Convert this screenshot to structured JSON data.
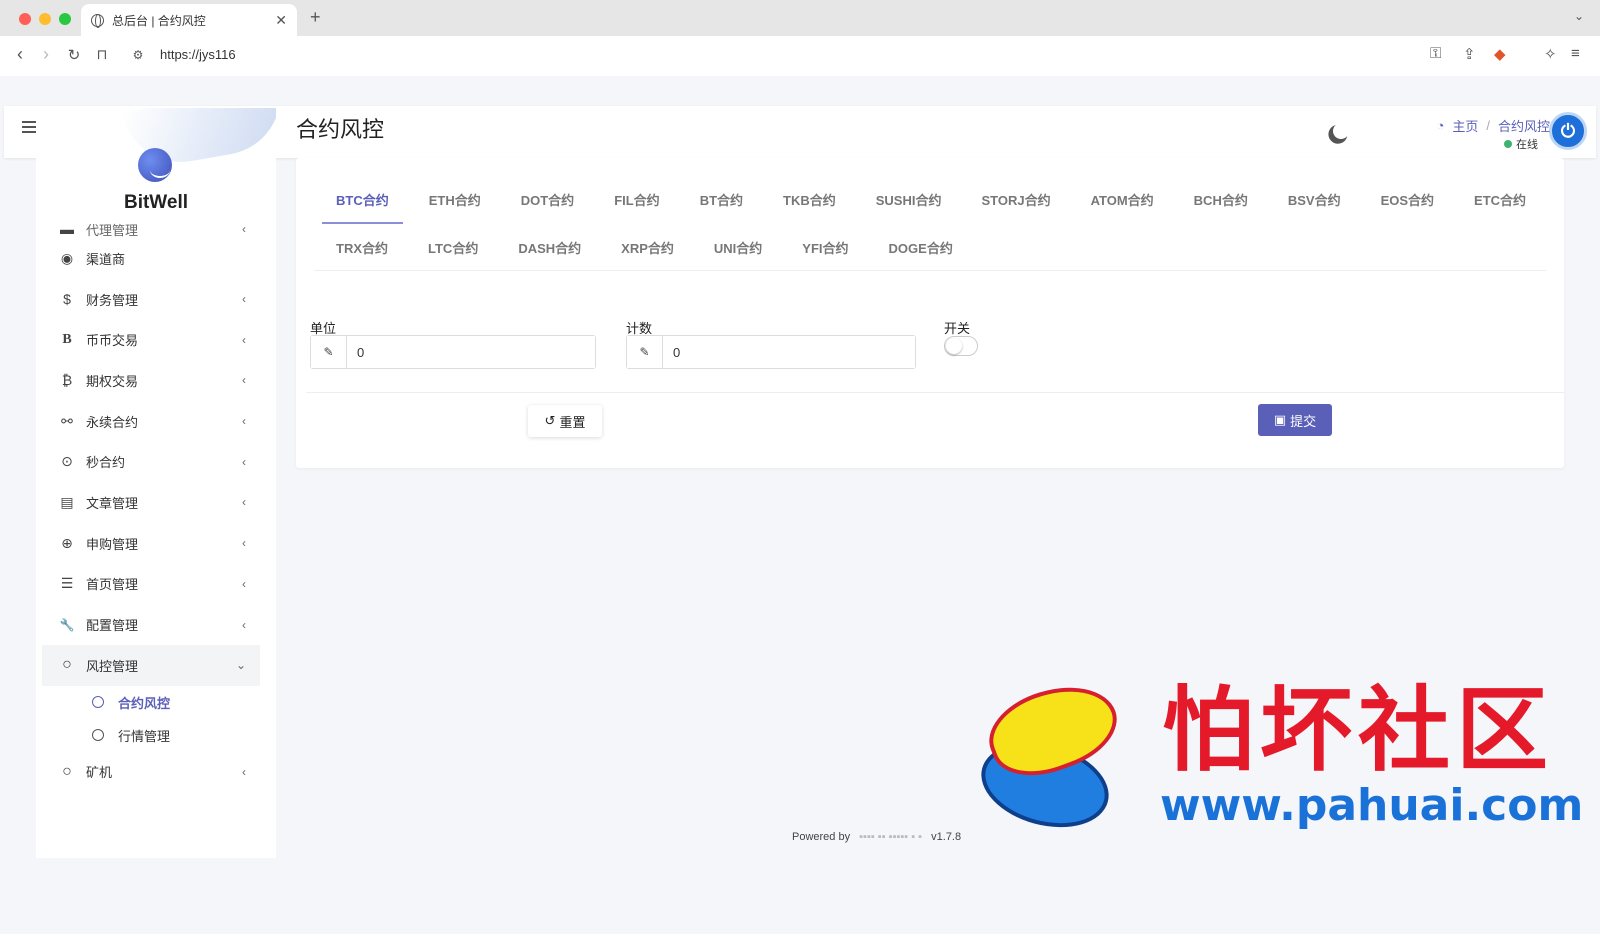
{
  "browser": {
    "tab_title": "总后台 | 合约风控",
    "url": "https://jys116",
    "new_tab": "+",
    "tab_close": "✕",
    "tab_menu": "⌄"
  },
  "topnav": {
    "status": "在线",
    "status_color": "#3cb371"
  },
  "sidebar": {
    "brand": "BitWell",
    "items": [
      {
        "label": "代理管理",
        "icon": "agent-icon",
        "glyph": "▬",
        "chevron": "‹"
      },
      {
        "label": "渠道商",
        "icon": "user-circle-icon",
        "glyph": "◉",
        "chevron": ""
      },
      {
        "label": "财务管理",
        "icon": "dollar-icon",
        "glyph": "$",
        "chevron": "‹"
      },
      {
        "label": "币币交易",
        "icon": "bold-b-icon",
        "glyph": "B",
        "chevron": "‹"
      },
      {
        "label": "期权交易",
        "icon": "bitcoin-icon",
        "glyph": "₿",
        "chevron": "‹"
      },
      {
        "label": "永续合约",
        "icon": "link-icon",
        "glyph": "⚯",
        "chevron": "‹"
      },
      {
        "label": "秒合约",
        "icon": "dot-circle-icon",
        "glyph": "⊙",
        "chevron": "‹"
      },
      {
        "label": "文章管理",
        "icon": "newspaper-icon",
        "glyph": "▤",
        "chevron": "‹"
      },
      {
        "label": "申购管理",
        "icon": "life-ring-icon",
        "glyph": "⊕",
        "chevron": "‹"
      },
      {
        "label": "首页管理",
        "icon": "list-icon",
        "glyph": "☰",
        "chevron": "‹"
      },
      {
        "label": "配置管理",
        "icon": "wrench-icon",
        "glyph": "🔧",
        "chevron": "‹"
      },
      {
        "label": "风控管理",
        "icon": "circle-icon",
        "glyph": "○",
        "chevron": "⌄"
      }
    ],
    "subitems": [
      {
        "label": "合约风控"
      },
      {
        "label": "行情管理"
      }
    ],
    "last_item": {
      "label": "矿机",
      "icon": "circle-icon",
      "glyph": "○",
      "chevron": "‹"
    }
  },
  "content": {
    "page_title": "合约风控",
    "breadcrumb": {
      "home": "主页",
      "separator": "/",
      "current": "合约风控"
    },
    "tabs_row1": [
      "BTC合约",
      "ETH合约",
      "DOT合约",
      "FIL合约",
      "BT合约",
      "TKB合约",
      "SUSHI合约",
      "STORJ合约",
      "ATOM合约",
      "BCH合约",
      "BSV合约",
      "EOS合约",
      "ETC合约"
    ],
    "tabs_row2": [
      "TRX合约",
      "LTC合约",
      "DASH合约",
      "XRP合约",
      "UNI合约",
      "YFI合约",
      "DOGE合约"
    ],
    "active_tab": "BTC合约",
    "form": {
      "unit_label": "单位",
      "unit_value": "0",
      "count_label": "计数",
      "count_value": "0",
      "switch_label": "开关",
      "switch_on": false
    },
    "reset_label": "重置",
    "submit_label": "提交",
    "accent_color": "#5a5fb8"
  },
  "footer": {
    "powered_by": "Powered by",
    "version": "v1.7.8"
  },
  "watermark": {
    "text": "怕坏社区",
    "url": "www.pahuai.com"
  }
}
